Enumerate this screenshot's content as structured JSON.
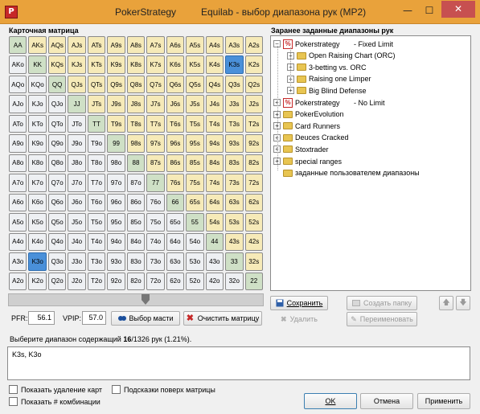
{
  "window": {
    "app_title": "PokerStrategy",
    "title": "Equilab - выбор диапазона рук (MP2)",
    "icon_glyph": "P"
  },
  "matrix": {
    "label": "Карточная матрица",
    "rows": [
      [
        "AA",
        "AKs",
        "AQs",
        "AJs",
        "ATs",
        "A9s",
        "A8s",
        "A7s",
        "A6s",
        "A5s",
        "A4s",
        "A3s",
        "A2s"
      ],
      [
        "AKo",
        "KK",
        "KQs",
        "KJs",
        "KTs",
        "K9s",
        "K8s",
        "K7s",
        "K6s",
        "K5s",
        "K4s",
        "K3s",
        "K2s"
      ],
      [
        "AQo",
        "KQo",
        "QQ",
        "QJs",
        "QTs",
        "Q9s",
        "Q8s",
        "Q7s",
        "Q6s",
        "Q5s",
        "Q4s",
        "Q3s",
        "Q2s"
      ],
      [
        "AJo",
        "KJo",
        "QJo",
        "JJ",
        "JTs",
        "J9s",
        "J8s",
        "J7s",
        "J6s",
        "J5s",
        "J4s",
        "J3s",
        "J2s"
      ],
      [
        "ATo",
        "KTo",
        "QTo",
        "JTo",
        "TT",
        "T9s",
        "T8s",
        "T7s",
        "T6s",
        "T5s",
        "T4s",
        "T3s",
        "T2s"
      ],
      [
        "A9o",
        "K9o",
        "Q9o",
        "J9o",
        "T9o",
        "99",
        "98s",
        "97s",
        "96s",
        "95s",
        "94s",
        "93s",
        "92s"
      ],
      [
        "A8o",
        "K8o",
        "Q8o",
        "J8o",
        "T8o",
        "98o",
        "88",
        "87s",
        "86s",
        "85s",
        "84s",
        "83s",
        "82s"
      ],
      [
        "A7o",
        "K7o",
        "Q7o",
        "J7o",
        "T7o",
        "97o",
        "87o",
        "77",
        "76s",
        "75s",
        "74s",
        "73s",
        "72s"
      ],
      [
        "A6o",
        "K6o",
        "Q6o",
        "J6o",
        "T6o",
        "96o",
        "86o",
        "76o",
        "66",
        "65s",
        "64s",
        "63s",
        "62s"
      ],
      [
        "A5o",
        "K5o",
        "Q5o",
        "J5o",
        "T5o",
        "95o",
        "85o",
        "75o",
        "65o",
        "55",
        "54s",
        "53s",
        "52s"
      ],
      [
        "A4o",
        "K4o",
        "Q4o",
        "J4o",
        "T4o",
        "94o",
        "84o",
        "74o",
        "64o",
        "54o",
        "44",
        "43s",
        "42s"
      ],
      [
        "A3o",
        "K3o",
        "Q3o",
        "J3o",
        "T3o",
        "93o",
        "83o",
        "73o",
        "63o",
        "53o",
        "43o",
        "33",
        "32s"
      ],
      [
        "A2o",
        "K2o",
        "Q2o",
        "J2o",
        "T2o",
        "92o",
        "82o",
        "72o",
        "62o",
        "52o",
        "42o",
        "32o",
        "22"
      ]
    ],
    "selected": [
      "K3s",
      "K3o"
    ]
  },
  "controls": {
    "pfr_label": "PFR:",
    "pfr_value": "56.1",
    "vpip_label": "VPIP:",
    "vpip_value": "57.0",
    "suits_button": "Выбор масти",
    "clear_button": "Очистить матрицу"
  },
  "ranges": {
    "label": "Заранее заданные диапазоны рук",
    "tree": [
      {
        "text": "Pokerstrategy       - Fixed Limit",
        "icon": "ps-icon",
        "expander": "−",
        "level": 0
      },
      {
        "text": "Open Raising Chart (ORC)",
        "icon": "folder-icon",
        "expander": "+",
        "level": 1
      },
      {
        "text": "3-betting vs. ORC",
        "icon": "folder-icon",
        "expander": "+",
        "level": 1
      },
      {
        "text": "Raising one Limper",
        "icon": "folder-icon",
        "expander": "+",
        "level": 1
      },
      {
        "text": "Big Blind Defense",
        "icon": "folder-icon",
        "expander": "+",
        "level": 1
      },
      {
        "text": "Pokerstrategy       - No Limit",
        "icon": "ps-icon",
        "expander": "+",
        "level": 0
      },
      {
        "text": "PokerEvolution",
        "icon": "folder-icon",
        "expander": "+",
        "level": 0
      },
      {
        "text": "Card Runners",
        "icon": "folder-icon",
        "expander": "+",
        "level": 0
      },
      {
        "text": "Deuces Cracked",
        "icon": "folder-icon",
        "expander": "+",
        "level": 0
      },
      {
        "text": "Stoxtrader",
        "icon": "folder-icon",
        "expander": "+",
        "level": 0
      },
      {
        "text": "special ranges",
        "icon": "folder-icon",
        "expander": "+",
        "level": 0
      },
      {
        "text": "заданные пользователем диапазоны",
        "icon": "folder-icon",
        "expander": "",
        "level": 0
      }
    ],
    "save_button": "Сохранить",
    "new_folder_button": "Создать папку",
    "delete_button": "Удалить",
    "rename_button": "Переименовать"
  },
  "summary": {
    "prefix": "Выберите диапазон содержащий ",
    "count": "16",
    "suffix": "/1326 рук (1.21%).",
    "hands_text": "K3s, K3o"
  },
  "footer": {
    "show_card_removal": "Показать удаление карт",
    "show_hints": "Подсказки поверх матрицы",
    "show_combos": "Показать # комбинации",
    "ok_button": "OK",
    "cancel_button": "Отмена",
    "apply_button": "Применить"
  },
  "colors": {
    "titlebar": "#e9a23b",
    "pair": "#cfe0c6",
    "suited": "#f6eab8",
    "offsuit": "#eef0f3",
    "selected": "#4a90d9",
    "close": "#c75050"
  }
}
